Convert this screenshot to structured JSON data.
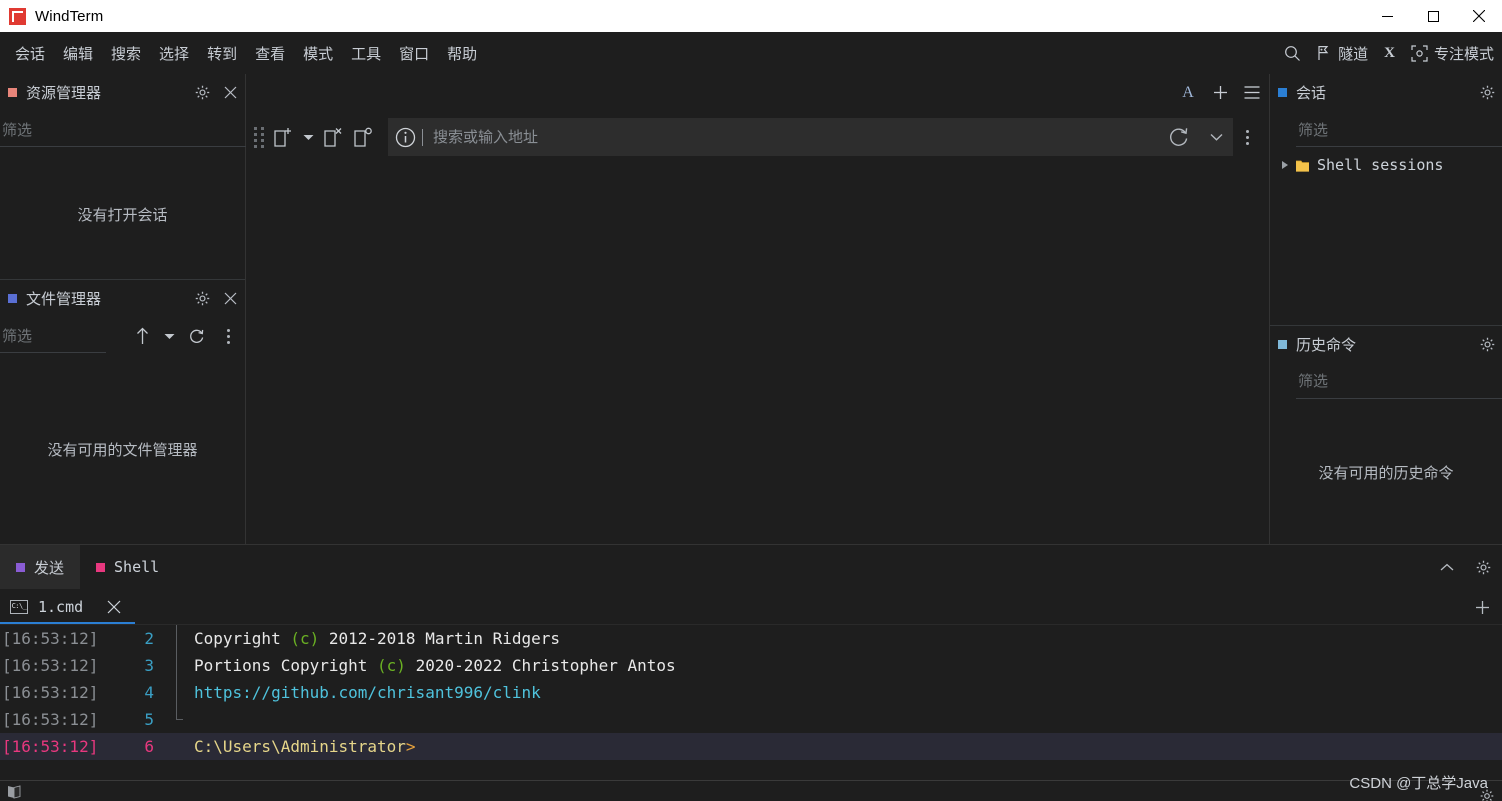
{
  "window": {
    "title": "WindTerm",
    "logo_color": "#e03a32",
    "controls": [
      {
        "name": "minimize",
        "glyph": "minimize-icon"
      },
      {
        "name": "maximize",
        "glyph": "maximize-icon"
      },
      {
        "name": "close",
        "glyph": "close-icon"
      }
    ]
  },
  "menubar": {
    "items": [
      {
        "label": "会话"
      },
      {
        "label": "编辑"
      },
      {
        "label": "搜索"
      },
      {
        "label": "选择"
      },
      {
        "label": "转到"
      },
      {
        "label": "查看"
      },
      {
        "label": "模式"
      },
      {
        "label": "工具"
      },
      {
        "label": "窗口"
      },
      {
        "label": "帮助"
      }
    ],
    "right_tools": [
      {
        "icon": "search-icon",
        "label": ""
      },
      {
        "icon": "tunnel-flag-icon",
        "label": "隧道"
      },
      {
        "icon": "x-letter-icon",
        "label": ""
      },
      {
        "icon": "focus-frame-icon",
        "label": "专注模式"
      }
    ]
  },
  "explorer": {
    "title": "资源管理器",
    "bullet_color": "#e8857a",
    "filter_placeholder": "筛选",
    "filter_value": "",
    "empty_message": "没有打开会话"
  },
  "filemanager": {
    "title": "文件管理器",
    "bullet_color": "#5a6fd4",
    "filter_placeholder": "筛选",
    "filter_value": "",
    "empty_message": "没有可用的文件管理器",
    "actions": [
      "up-arrow-icon",
      "chevron-down-icon",
      "refresh-icon",
      "more-options-icon"
    ]
  },
  "center": {
    "top_actions": [
      "font-size-icon",
      "plus-icon",
      "hamburger-menu-icon"
    ],
    "top_font_label": "A",
    "toolbar_icons": [
      "drag-grip-icon",
      "new-tab-icon",
      "chevron-down-icon",
      "close-tab-icon",
      "clone-tab-icon"
    ],
    "address": {
      "placeholder": "搜索或输入地址",
      "value": "",
      "info_icon": "info-icon",
      "reload_icon": "reload-icon",
      "chevron_icon": "chevron-down-icon"
    },
    "more_icon": "more-options-icon"
  },
  "sessions": {
    "title": "会话",
    "bullet_color": "#2b7fd4",
    "gear_icon": "gear-icon",
    "filter_placeholder": "筛选",
    "filter_value": "",
    "tree": [
      {
        "label": "Shell sessions",
        "icon": "folder-icon",
        "expanded": false,
        "folder_color": "#f3c24a"
      }
    ]
  },
  "history": {
    "title": "历史命令",
    "bullet_color": "#7fb8d8",
    "gear_icon": "gear-icon",
    "filter_placeholder": "筛选",
    "filter_value": "",
    "empty_message": "没有可用的历史命令"
  },
  "dock": {
    "tabs": [
      {
        "label": "发送",
        "bullet_color": "#8a5cd4",
        "active": true,
        "mono": false
      },
      {
        "label": "Shell",
        "bullet_color": "#e8387f",
        "active": false,
        "mono": true
      }
    ],
    "actions": [
      "collapse-chevron-icon",
      "gear-icon"
    ],
    "terminal_tabs": [
      {
        "label": "1.cmd",
        "icon": "cmd-icon",
        "icon_text": "C:\\_",
        "active": true,
        "close_icon": "close-icon"
      }
    ],
    "add_tab_icon": "plus-icon"
  },
  "terminal": {
    "lines": [
      {
        "timestamp": "[16:53:12]",
        "line_number": "2",
        "fold": "bar",
        "current": false,
        "segments": [
          {
            "text": "Copyright ",
            "color": "white"
          },
          {
            "text": "(c)",
            "color": "green"
          },
          {
            "text": " 2012-2018 Martin Ridgers",
            "color": "white"
          }
        ]
      },
      {
        "timestamp": "[16:53:12]",
        "line_number": "3",
        "fold": "bar",
        "current": false,
        "segments": [
          {
            "text": "Portions Copyright ",
            "color": "white"
          },
          {
            "text": "(c)",
            "color": "green"
          },
          {
            "text": " 2020-2022 Christopher Antos",
            "color": "white"
          }
        ]
      },
      {
        "timestamp": "[16:53:12]",
        "line_number": "4",
        "fold": "bar",
        "current": false,
        "segments": [
          {
            "text": "https://github.com/chrisant996/clink",
            "color": "cyan"
          }
        ]
      },
      {
        "timestamp": "[16:53:12]",
        "line_number": "5",
        "fold": "end",
        "current": false,
        "segments": [
          {
            "text": "",
            "color": "white"
          }
        ]
      },
      {
        "timestamp": "[16:53:12]",
        "line_number": "6",
        "fold": "none",
        "current": true,
        "segments": [
          {
            "text": "C:\\Users\\Administrator",
            "color": "yellow"
          },
          {
            "text": ">",
            "color": "orange"
          }
        ]
      }
    ]
  },
  "statusbar": {
    "icon": "panel-toggle-icon"
  },
  "watermark": {
    "text": "CSDN @丁总学Java"
  }
}
